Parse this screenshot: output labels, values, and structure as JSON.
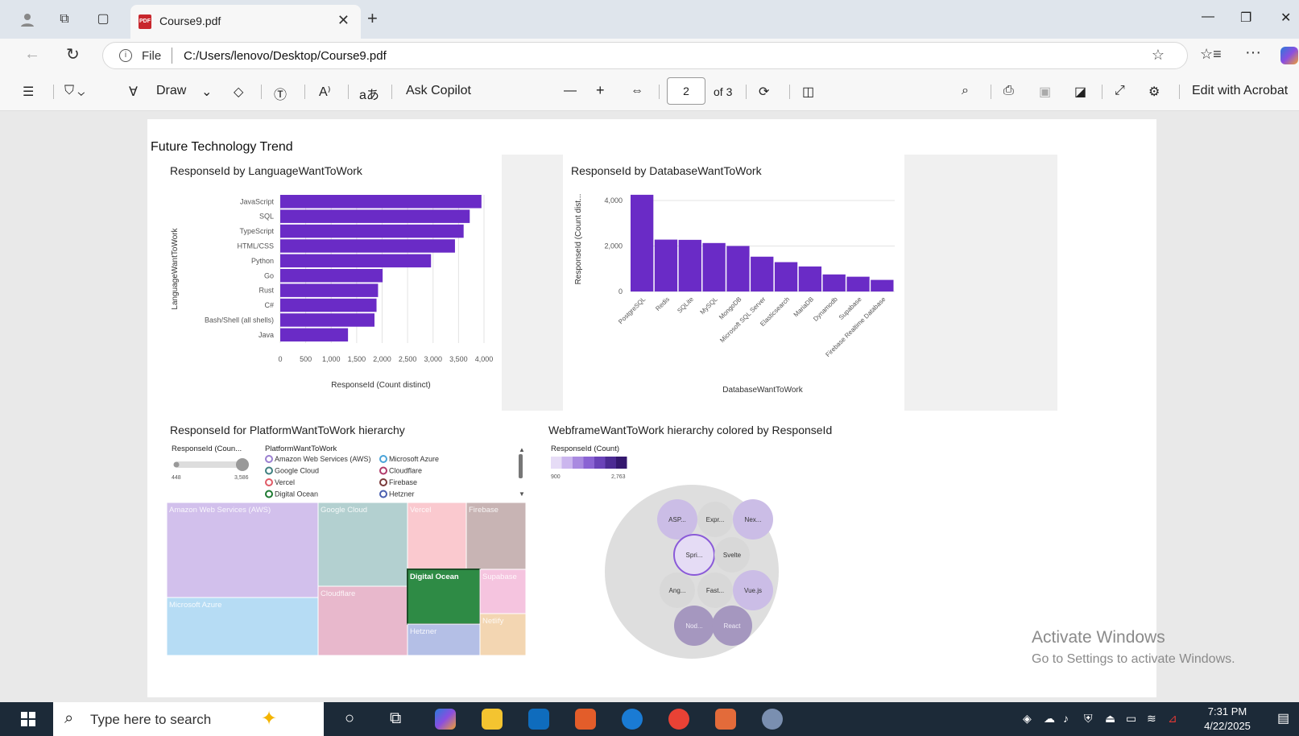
{
  "browser": {
    "tab_title": "Course9.pdf",
    "tab_close": "✕",
    "new_tab": "+",
    "url_prefix": "File",
    "url": "C:/Users/lenovo/Desktop/Course9.pdf"
  },
  "toolbar": {
    "draw_label": "Draw",
    "ask_copilot_label": "Ask Copilot",
    "page_number": "2",
    "page_total": "of 3",
    "edit_acrobat_label": "Edit with Acrobat"
  },
  "report": {
    "title": "Future Technology Trend"
  },
  "chart_data": [
    {
      "type": "bar",
      "orientation": "horizontal",
      "title": "ResponseId by LanguageWantToWork",
      "xlabel": "ResponseId (Count distinct)",
      "ylabel": "LanguageWantToWork",
      "categories": [
        "JavaScript",
        "SQL",
        "TypeScript",
        "HTML/CSS",
        "Python",
        "Go",
        "Rust",
        "C#",
        "Bash/Shell (all shells)",
        "Java"
      ],
      "values": [
        3950,
        3720,
        3600,
        3430,
        2960,
        2010,
        1920,
        1890,
        1850,
        1330
      ],
      "xticks": [
        "0",
        "500",
        "1,000",
        "1,500",
        "2,000",
        "2,500",
        "3,000",
        "3,500",
        "4,000"
      ],
      "xlim": [
        0,
        4000
      ],
      "color": "#6a2bc6",
      "grid": true
    },
    {
      "type": "bar",
      "title": "ResponseId by DatabaseWantToWork",
      "xlabel": "DatabaseWantToWork",
      "ylabel": "ResponseId (Count dist...",
      "categories": [
        "PostgreSQL",
        "Redis",
        "SQLite",
        "MySQL",
        "MongoDB",
        "Microsoft SQL Server",
        "Elasticsearch",
        "MariaDB",
        "Dynamodb",
        "Supabase",
        "Firebase Realtime Database"
      ],
      "values": [
        4250,
        2280,
        2270,
        2130,
        2000,
        1530,
        1290,
        1100,
        750,
        650,
        510
      ],
      "yticks": [
        "0",
        "2,000",
        "4,000"
      ],
      "ylim": [
        0,
        4600
      ],
      "color": "#6a2bc6",
      "grid": true
    },
    {
      "type": "treemap",
      "title": "ResponseId for PlatformWantToWork hierarchy",
      "size_legend_title": "ResponseId (Coun...",
      "size_min": "448",
      "size_max": "3,586",
      "color_legend_title": "PlatformWantToWork",
      "legend": [
        {
          "label": "Amazon Web Services (AWS)",
          "color": "#9a7fd0"
        },
        {
          "label": "Microsoft Azure",
          "color": "#4aa3d8"
        },
        {
          "label": "Google Cloud",
          "color": "#3f8080"
        },
        {
          "label": "Cloudflare",
          "color": "#b03a6a"
        },
        {
          "label": "Vercel",
          "color": "#e05a66"
        },
        {
          "label": "Firebase",
          "color": "#7a3a3a"
        },
        {
          "label": "Digital Ocean",
          "color": "#1e7a32"
        },
        {
          "label": "Hetzner",
          "color": "#4a5fb0"
        }
      ],
      "tiles": [
        {
          "label": "Amazon Web Services (AWS)",
          "color": "#d2c0ec"
        },
        {
          "label": "Microsoft Azure",
          "color": "#b6dcf4"
        },
        {
          "label": "Google Cloud",
          "color": "#b3d0d0"
        },
        {
          "label": "Cloudflare",
          "color": "#e8b8cc"
        },
        {
          "label": "Vercel",
          "color": "#fac9cf"
        },
        {
          "label": "Firebase",
          "color": "#c8b4b4"
        },
        {
          "label": "Digital Ocean",
          "color": "#2e8b45"
        },
        {
          "label": "Supabase",
          "color": "#f5c4df"
        },
        {
          "label": "Hetzner",
          "color": "#b4bfe6"
        },
        {
          "label": "Netlify",
          "color": "#f3d6b2"
        }
      ]
    },
    {
      "type": "circle-packing",
      "title": "WebframeWantToWork hierarchy colored by ResponseId",
      "legend_title": "ResponseId (Count)",
      "legend_min": "900",
      "legend_max": "2,763",
      "nodes": [
        {
          "label": "ASP...",
          "color": "#cbbde6"
        },
        {
          "label": "Expr...",
          "color": "#d8d8d8"
        },
        {
          "label": "Nex...",
          "color": "#cbbde6"
        },
        {
          "label": "Spri...",
          "color": "#e5dcf5"
        },
        {
          "label": "Svelte",
          "color": "#d8d8d8"
        },
        {
          "label": "Ang...",
          "color": "#d8d8d8"
        },
        {
          "label": "Fast...",
          "color": "#d8d8d8"
        },
        {
          "label": "Vue.js",
          "color": "#cbbde6"
        },
        {
          "label": "Nod...",
          "color": "#a597bf"
        },
        {
          "label": "React",
          "color": "#a597bf"
        }
      ]
    }
  ],
  "watermark": {
    "line1": "Activate Windows",
    "line2": "Go to Settings to activate Windows."
  },
  "taskbar": {
    "search_placeholder": "Type here to search",
    "time": "7:31 PM",
    "date": "4/22/2025"
  }
}
